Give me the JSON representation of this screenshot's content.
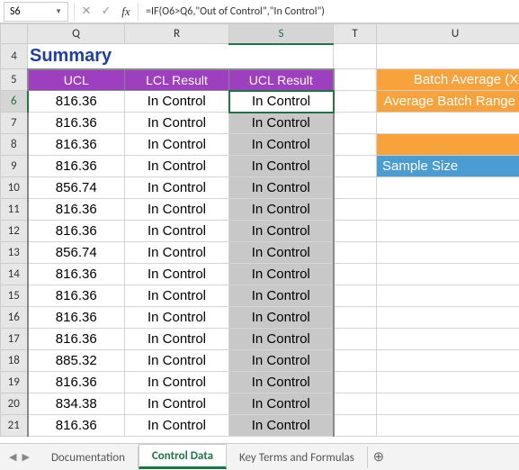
{
  "formula_bar": {
    "cell_ref": "S6",
    "cancel": "✕",
    "confirm": "✓",
    "fx": "fx",
    "formula": "=IF(O6>Q6,\"Out of Control\",\"In Control\")"
  },
  "columns": [
    "Q",
    "R",
    "S",
    "T",
    "U"
  ],
  "summary_title": "Summary",
  "headers": {
    "q": "UCL",
    "r": "LCL Result",
    "s": "UCL Result"
  },
  "right_panel": {
    "batch_avg": "Batch Average (Xba",
    "avg_range": "Average Batch Range (R",
    "sample_size": "Sample Size"
  },
  "rows": [
    {
      "n": 6,
      "ucl": "816.36",
      "lcl": "In Control",
      "uclr": "In Control",
      "sel": true
    },
    {
      "n": 7,
      "ucl": "816.36",
      "lcl": "In Control",
      "uclr": "In Control"
    },
    {
      "n": 8,
      "ucl": "816.36",
      "lcl": "In Control",
      "uclr": "In Control"
    },
    {
      "n": 9,
      "ucl": "816.36",
      "lcl": "In Control",
      "uclr": "In Control"
    },
    {
      "n": 10,
      "ucl": "856.74",
      "lcl": "In Control",
      "uclr": "In Control"
    },
    {
      "n": 11,
      "ucl": "816.36",
      "lcl": "In Control",
      "uclr": "In Control"
    },
    {
      "n": 12,
      "ucl": "816.36",
      "lcl": "In Control",
      "uclr": "In Control"
    },
    {
      "n": 13,
      "ucl": "856.74",
      "lcl": "In Control",
      "uclr": "In Control"
    },
    {
      "n": 14,
      "ucl": "816.36",
      "lcl": "In Control",
      "uclr": "In Control"
    },
    {
      "n": 15,
      "ucl": "816.36",
      "lcl": "In Control",
      "uclr": "In Control"
    },
    {
      "n": 16,
      "ucl": "816.36",
      "lcl": "In Control",
      "uclr": "In Control"
    },
    {
      "n": 17,
      "ucl": "816.36",
      "lcl": "In Control",
      "uclr": "In Control"
    },
    {
      "n": 18,
      "ucl": "885.32",
      "lcl": "In Control",
      "uclr": "In Control"
    },
    {
      "n": 19,
      "ucl": "816.36",
      "lcl": "In Control",
      "uclr": "In Control"
    },
    {
      "n": 20,
      "ucl": "834.38",
      "lcl": "In Control",
      "uclr": "In Control"
    },
    {
      "n": 21,
      "ucl": "816.36",
      "lcl": "In Control",
      "uclr": "In Control"
    }
  ],
  "tabs": {
    "documentation": "Documentation",
    "control_data": "Control Data",
    "key_terms": "Key Terms and Formulas"
  },
  "add_sheet": "⊕",
  "paste_options": "⎘"
}
